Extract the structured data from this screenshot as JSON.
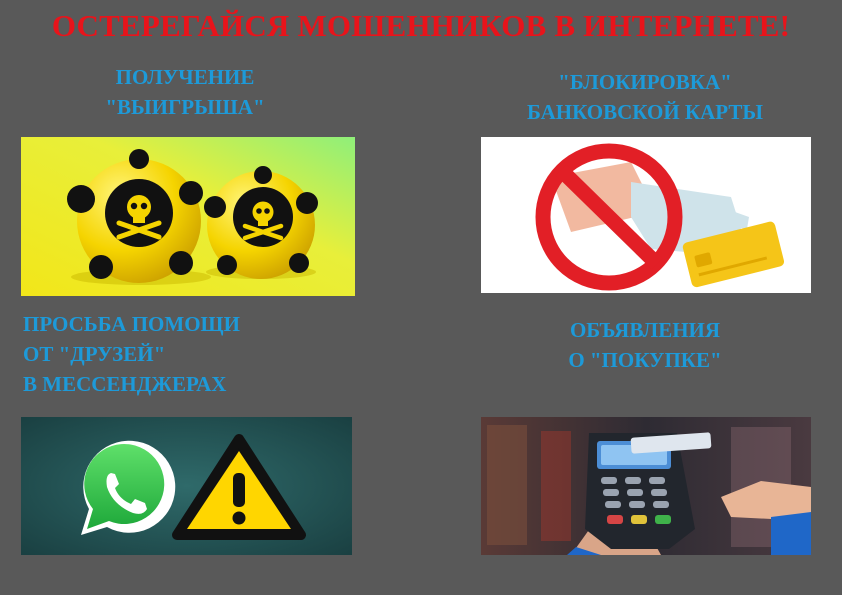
{
  "title": "ОСТЕРЕГАЙСЯ МОШЕННИКОВ В ИНТЕРНЕТЕ!",
  "sections": [
    {
      "lines": [
        "ПОЛУЧЕНИЕ",
        "\"ВЫИГРЫША\""
      ]
    },
    {
      "lines": [
        "\"БЛОКИРОВКА\"",
        "БАНКОВСКОЙ КАРТЫ"
      ]
    },
    {
      "lines": [
        "ПРОСЬБА ПОМОЩИ",
        "ОТ \"ДРУЗЕЙ\"",
        "В МЕССЕНДЖЕРАХ"
      ]
    },
    {
      "lines": [
        "ОБЪЯВЛЕНИЯ",
        "О \"ПОКУПКЕ\""
      ]
    }
  ],
  "colors": {
    "background": "#595959",
    "title": "#e8141b",
    "section_text": "#1d9ad9"
  },
  "images": [
    {
      "icon": "poison-ball-icon"
    },
    {
      "icon": "prohibited-card-icon"
    },
    {
      "icons": [
        "whatsapp-icon",
        "warning-icon"
      ]
    },
    {
      "icon": "payment-terminal-icon"
    }
  ]
}
